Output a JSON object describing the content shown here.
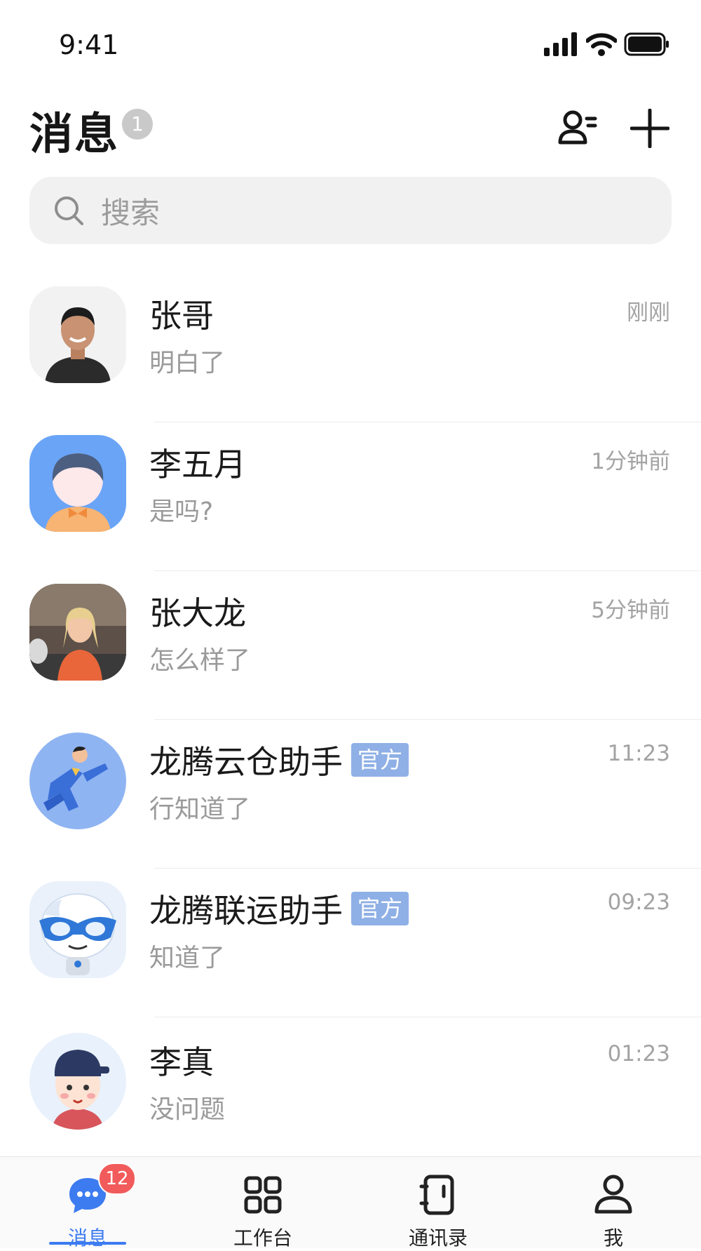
{
  "status": {
    "time": "9:41"
  },
  "header": {
    "title": "消息",
    "unread_badge": "1"
  },
  "search": {
    "placeholder": "搜索"
  },
  "conversations": [
    {
      "name": "张哥",
      "preview": "明白了",
      "time": "刚刚",
      "tag": ""
    },
    {
      "name": "李五月",
      "preview": "是吗?",
      "time": "1分钟前",
      "tag": ""
    },
    {
      "name": "张大龙",
      "preview": "怎么样了",
      "time": "5分钟前",
      "tag": ""
    },
    {
      "name": "龙腾云仓助手",
      "preview": "行知道了",
      "time": "11:23",
      "tag": "官方"
    },
    {
      "name": "龙腾联运助手",
      "preview": "知道了",
      "time": "09:23",
      "tag": "官方"
    },
    {
      "name": "李真",
      "preview": "没问题",
      "time": "01:23",
      "tag": ""
    }
  ],
  "tabbar": {
    "tabs": [
      {
        "label": "消息",
        "badge": "12",
        "icon": "chat-bubble-icon"
      },
      {
        "label": "工作台",
        "icon": "grid-icon"
      },
      {
        "label": "通讯录",
        "icon": "contacts-book-icon"
      },
      {
        "label": "我",
        "icon": "profile-icon"
      }
    ]
  },
  "colors": {
    "accent": "#3d7bf0",
    "badge": "#f25b5b",
    "official_tag": "#8fb0e6"
  }
}
